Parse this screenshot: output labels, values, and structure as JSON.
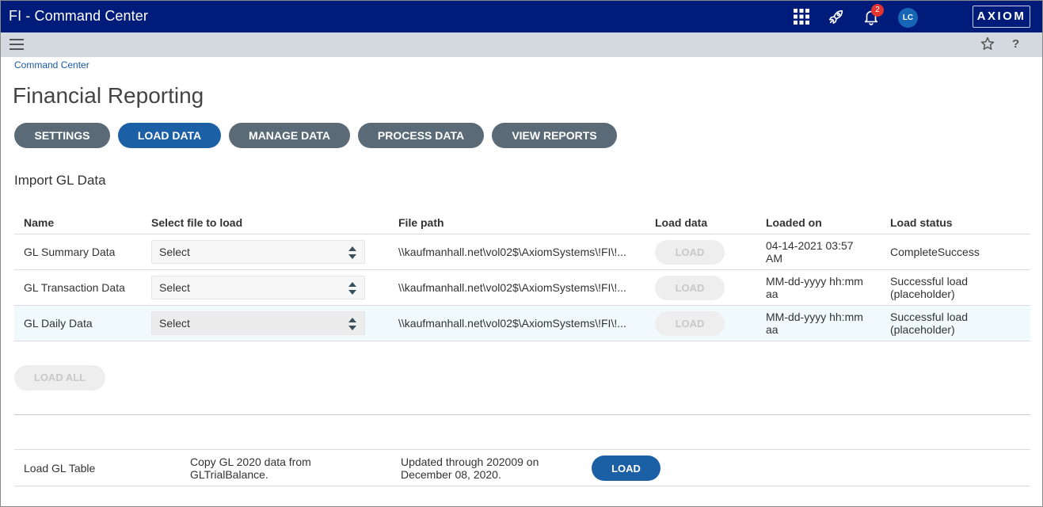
{
  "app": {
    "title": "FI - Command Center",
    "notification_count": "2",
    "user_initials": "LC",
    "logo_text": "AXIOM"
  },
  "colors": {
    "topbar": "#001c7a",
    "accent": "#1b5fa5",
    "tab_default": "#5a6b77",
    "badge": "#e3342f"
  },
  "icons": {
    "apps": "apps-grid-icon",
    "rocket": "rocket-icon",
    "bell": "bell-icon",
    "menu": "hamburger-icon",
    "star": "star-icon",
    "help": "help-icon"
  },
  "breadcrumb": "Command Center",
  "page_title": "Financial Reporting",
  "tabs": [
    {
      "label": "SETTINGS",
      "active": false
    },
    {
      "label": "LOAD DATA",
      "active": true
    },
    {
      "label": "MANAGE DATA",
      "active": false
    },
    {
      "label": "PROCESS DATA",
      "active": false
    },
    {
      "label": "VIEW REPORTS",
      "active": false
    }
  ],
  "help_label": "?",
  "section_title": "Import GL Data",
  "table": {
    "headers": {
      "name": "Name",
      "select": "Select file to load",
      "path": "File path",
      "load": "Load data",
      "loaded_on": "Loaded on",
      "status": "Load status"
    },
    "rows": [
      {
        "name": "GL Summary Data",
        "select": "Select",
        "path": "\\\\kaufmanhall.net\\vol02$\\AxiomSystems\\!FI\\!...",
        "load": "LOAD",
        "loaded_on": "04-14-2021 03:57 AM",
        "status": "CompleteSuccess"
      },
      {
        "name": "GL Transaction Data",
        "select": "Select",
        "path": "\\\\kaufmanhall.net\\vol02$\\AxiomSystems\\!FI\\!...",
        "load": "LOAD",
        "loaded_on": "MM-dd-yyyy hh:mm aa",
        "status": "Successful load (placeholder)"
      },
      {
        "name": "GL Daily Data",
        "select": "Select",
        "path": "\\\\kaufmanhall.net\\vol02$\\AxiomSystems\\!FI\\!...",
        "load": "LOAD",
        "loaded_on": "MM-dd-yyyy hh:mm aa",
        "status": "Successful load (placeholder)"
      }
    ]
  },
  "load_all_label": "LOAD ALL",
  "gl_table": {
    "label": "Load GL Table",
    "description": "Copy GL 2020 data from GLTrialBalance.",
    "updated": "Updated through 202009 on December 08, 2020.",
    "button": "LOAD"
  }
}
